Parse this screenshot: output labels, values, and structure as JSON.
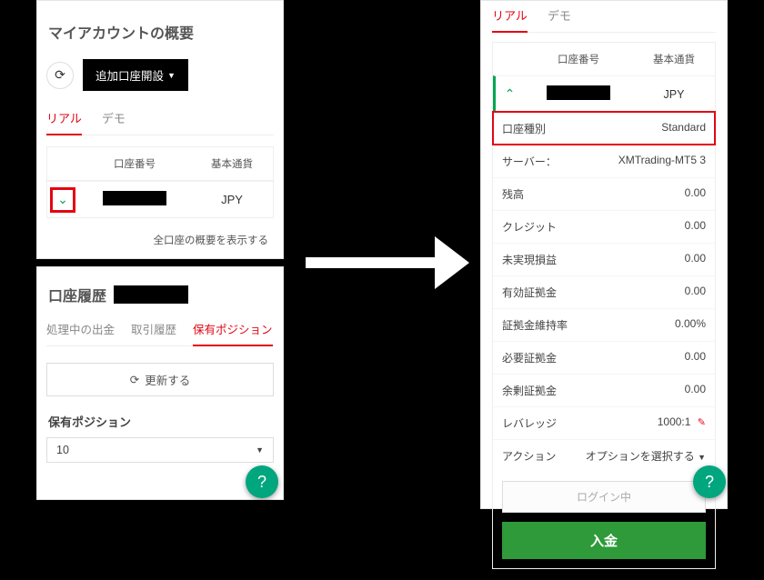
{
  "left": {
    "overview_title": "マイアカウントの概要",
    "open_account_btn": "追加口座開設",
    "tabs": {
      "real": "リアル",
      "demo": "デモ"
    },
    "table": {
      "col_account_number": "口座番号",
      "col_base_currency": "基本通貨",
      "row1_currency": "JPY",
      "footer": "全口座の概要を表示する"
    },
    "history": {
      "title": "口座履歴",
      "tabs": {
        "withdrawals": "処理中の出金",
        "trade_history": "取引履歴",
        "positions": "保有ポジション"
      },
      "refresh_btn": "更新する",
      "positions_label": "保有ポジション",
      "page_size": "10"
    }
  },
  "right": {
    "tabs": {
      "real": "リアル",
      "demo": "デモ"
    },
    "table": {
      "col_account_number": "口座番号",
      "col_base_currency": "基本通貨",
      "row1_currency": "JPY"
    },
    "details": {
      "account_type_label": "口座種別",
      "account_type_value": "Standard",
      "server_label": "サーバー：",
      "server_value": "XMTrading-MT5 3",
      "balance_label": "残高",
      "balance_value": "0.00",
      "credit_label": "クレジット",
      "credit_value": "0.00",
      "unrealized_pl_label": "未実現損益",
      "unrealized_pl_value": "0.00",
      "equity_label": "有効証拠金",
      "equity_value": "0.00",
      "margin_level_label": "証拠金維持率",
      "margin_level_value": "0.00%",
      "required_margin_label": "必要証拠金",
      "required_margin_value": "0.00",
      "free_margin_label": "余剰証拠金",
      "free_margin_value": "0.00",
      "leverage_label": "レバレッジ",
      "leverage_value": "1000:1",
      "action_label": "アクション",
      "action_value": "オプションを選択する"
    },
    "login_btn": "ログイン中",
    "deposit_btn": "入金"
  },
  "icons": {
    "refresh": "⟳",
    "caret_down": "▼",
    "chevron_down": "⌄",
    "chevron_up": "⌃",
    "pencil": "✎",
    "help": "?"
  }
}
